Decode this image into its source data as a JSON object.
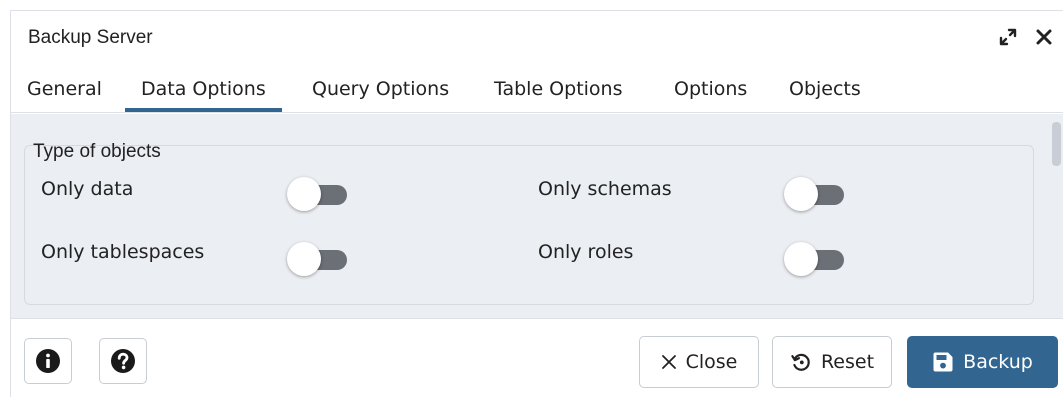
{
  "dialog": {
    "title": "Backup Server",
    "expand_icon": "expand-icon",
    "close_icon": "close-icon"
  },
  "tabs": [
    {
      "label": "General",
      "active": false
    },
    {
      "label": "Data Options",
      "active": true
    },
    {
      "label": "Query Options",
      "active": false
    },
    {
      "label": "Table Options",
      "active": false
    },
    {
      "label": "Options",
      "active": false
    },
    {
      "label": "Objects",
      "active": false
    }
  ],
  "section": {
    "legend": "Type of objects",
    "options": [
      {
        "label": "Only data",
        "checked": false
      },
      {
        "label": "Only schemas",
        "checked": false
      },
      {
        "label": "Only tablespaces",
        "checked": false
      },
      {
        "label": "Only roles",
        "checked": false
      }
    ]
  },
  "footer": {
    "info_icon": "info-icon",
    "help_icon": "help-icon",
    "close_label": "Close",
    "reset_label": "Reset",
    "backup_label": "Backup"
  },
  "colors": {
    "accent": "#326690",
    "content_bg": "#ebeef3",
    "toggle_off_track": "#6b6f76"
  }
}
